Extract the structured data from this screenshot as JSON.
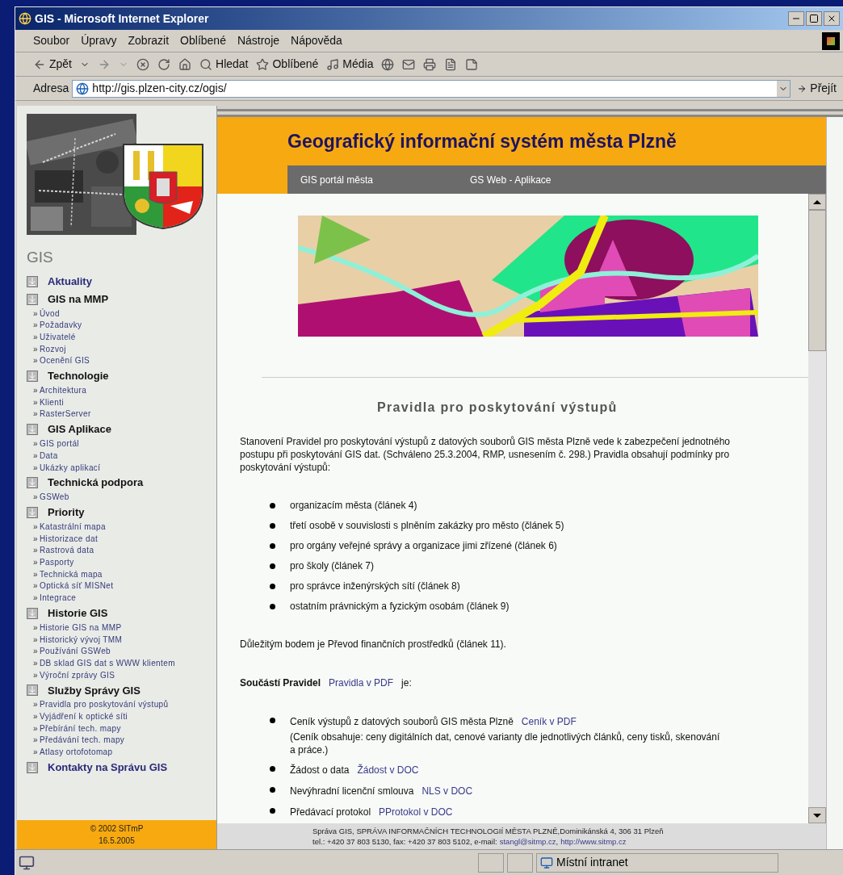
{
  "window": {
    "title": "GIS - Microsoft Internet Explorer"
  },
  "menu": [
    "Soubor",
    "Úpravy",
    "Zobrazit",
    "Oblíbené",
    "Nástroje",
    "Nápověda"
  ],
  "toolbar": {
    "back": "Zpět",
    "search": "Hledat",
    "favorites": "Oblíbené",
    "media": "Média"
  },
  "address": {
    "label": "Adresa",
    "url": "http://gis.plzen-city.cz/ogis/",
    "go": "Přejít"
  },
  "sidebar": {
    "title": "GIS",
    "sections": [
      {
        "title": "Aktuality",
        "kind": "link"
      },
      {
        "title": "GIS na MMP",
        "kind": "heading",
        "items": [
          "Úvod",
          "Požadavky",
          "Uživatelé",
          "Rozvoj",
          "Ocenění GIS"
        ]
      },
      {
        "title": "Technologie",
        "kind": "heading",
        "items": [
          "Architektura",
          "Klienti",
          "RasterServer"
        ]
      },
      {
        "title": "GIS Aplikace",
        "kind": "heading",
        "items": [
          "GIS portál",
          "Data",
          "Ukázky aplikací"
        ]
      },
      {
        "title": "Technická podpora",
        "kind": "heading",
        "items": [
          "GSWeb"
        ]
      },
      {
        "title": "Priority",
        "kind": "heading",
        "items": [
          "Katastrální mapa",
          "Historizace dat",
          "Rastrová data",
          "Pasporty",
          "Technická mapa",
          "Optická síť MISNet",
          "Integrace"
        ]
      },
      {
        "title": "Historie GIS",
        "kind": "heading",
        "items": [
          "Historie GIS na MMP",
          "Historický vývoj TMM",
          "Používání GSWeb",
          "DB sklad GIS dat s WWW klientem",
          "Výroční zprávy GIS"
        ]
      },
      {
        "title": "Služby Správy GIS",
        "kind": "heading",
        "items": [
          "Pravidla pro poskytování výstupů",
          "Vyjádření k optické síti",
          "Přebírání tech. mapy",
          "Předávání tech. mapy",
          "Atlasy ortofotomap"
        ]
      },
      {
        "title": "Kontakty na Správu GIS",
        "kind": "link"
      }
    ],
    "marker": "»",
    "footer": [
      "© 2002 SITmP",
      "16.5.2005"
    ]
  },
  "header": {
    "title": "Geografický informační systém města Plzně",
    "nav": [
      "GIS portál města",
      "GS Web - Aplikace"
    ]
  },
  "content": {
    "heading": "Pravidla pro poskytování výstupů",
    "intro": "Stanovení Pravidel pro poskytování výstupů z datových souborů GIS města Plzně vede k zabezpečení jednotného postupu při poskytování GIS dat. (Schváleno 25.3.2004, RMP, usnesením č. 298.) Pravidla obsahují podmínky pro poskytování výstupů:",
    "rules": [
      "organizacím města (článek 4)",
      "třetí osobě v souvislosti s plněním zakázky pro město (článek 5)",
      "pro orgány veřejné správy a organizace jimi zřízené (článek 6)",
      "pro školy (článek 7)",
      "pro správce inženýrských sítí (článek 8)",
      "ostatním právnickým a fyzickým osobám (článek 9)"
    ],
    "note": "Důležitým bodem je Převod finančních prostředků (článek 11).",
    "parts_label": "Součástí Pravidel",
    "parts_link": "Pravidla v PDF",
    "parts_suffix": "je:",
    "documents": [
      {
        "text": "Ceník výstupů z datových souborů GIS města Plzně",
        "link": "Ceník v PDF",
        "note": "(Ceník obsahuje: ceny digitálních dat, cenové varianty dle jednotlivých článků, ceny tisků, skenování a práce.)"
      },
      {
        "text": "Žádost o data",
        "link": "Žádost v DOC"
      },
      {
        "text": "Nevýhradní licenční smlouva",
        "link": "NLS v DOC"
      },
      {
        "text": "Předávací protokol",
        "link": "PProtokol v DOC"
      }
    ]
  },
  "page_footer": {
    "line1": "Správa GIS, SPRÁVA INFORMAČNÍCH TECHNOLOGIÍ MĚSTA PLZNĚ,Dominikánská 4, 306 31 Plzeň",
    "line2": "tel.: +420 37 803 5130, fax: +420 37 803 5102, e-mail:",
    "email": "stangl@sitmp.cz",
    "separator": ",",
    "web": "http://www.sitmp.cz"
  },
  "status_bar": {
    "zone": "Místní intranet"
  }
}
